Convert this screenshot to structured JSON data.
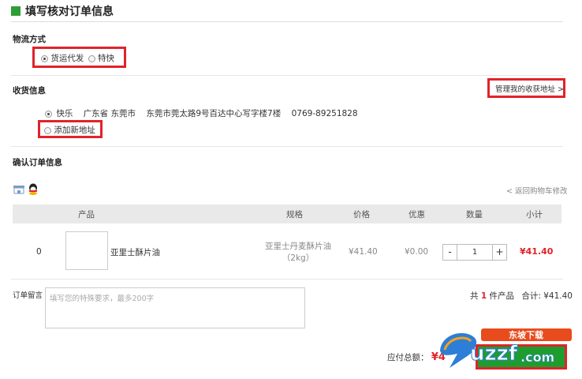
{
  "header": {
    "title": "填写核对订单信息"
  },
  "logistics": {
    "label": "物流方式",
    "options": [
      {
        "label": "货运代发",
        "checked": true
      },
      {
        "label": "特快",
        "checked": false
      }
    ]
  },
  "shipping": {
    "label": "收货信息",
    "manage_link": "管理我的收获地址 >",
    "address": {
      "name": "快乐",
      "region": "广东省 东莞市",
      "street": "东莞市莞太路9号百达中心写字楼7楼",
      "phone": "0769-89251828",
      "checked": true
    },
    "add_new": "添加新地址"
  },
  "confirm": {
    "label": "确认订单信息",
    "back_link": "< 返回购物车修改"
  },
  "table": {
    "headers": {
      "product": "产品",
      "spec": "规格",
      "price": "价格",
      "discount": "优惠",
      "qty": "数量",
      "subtotal": "小计"
    },
    "rows": [
      {
        "index": "0",
        "name": "亚里士酥片油",
        "spec_line1": "亚里士丹麦酥片油",
        "spec_line2": "（2kg）",
        "price": "¥41.40",
        "discount": "¥0.00",
        "qty": "1",
        "minus": "-",
        "plus": "+",
        "subtotal": "¥41.40"
      }
    ]
  },
  "note": {
    "label": "订单留言",
    "placeholder": "填写您的特殊要求，最多200字"
  },
  "summary": {
    "count_prefix": "共",
    "count": "1",
    "count_suffix": "件产品",
    "total_label": "合计:",
    "total": "¥41.40"
  },
  "payable": {
    "label": "应付总额：",
    "amount": "¥4"
  },
  "watermark": {
    "brand": "uzzf",
    "badge": "东坡下载",
    "domain": ".com"
  },
  "colors": {
    "accent": "#2e9e36",
    "highlight": "#e0232a",
    "price_red": "#e0232a"
  }
}
